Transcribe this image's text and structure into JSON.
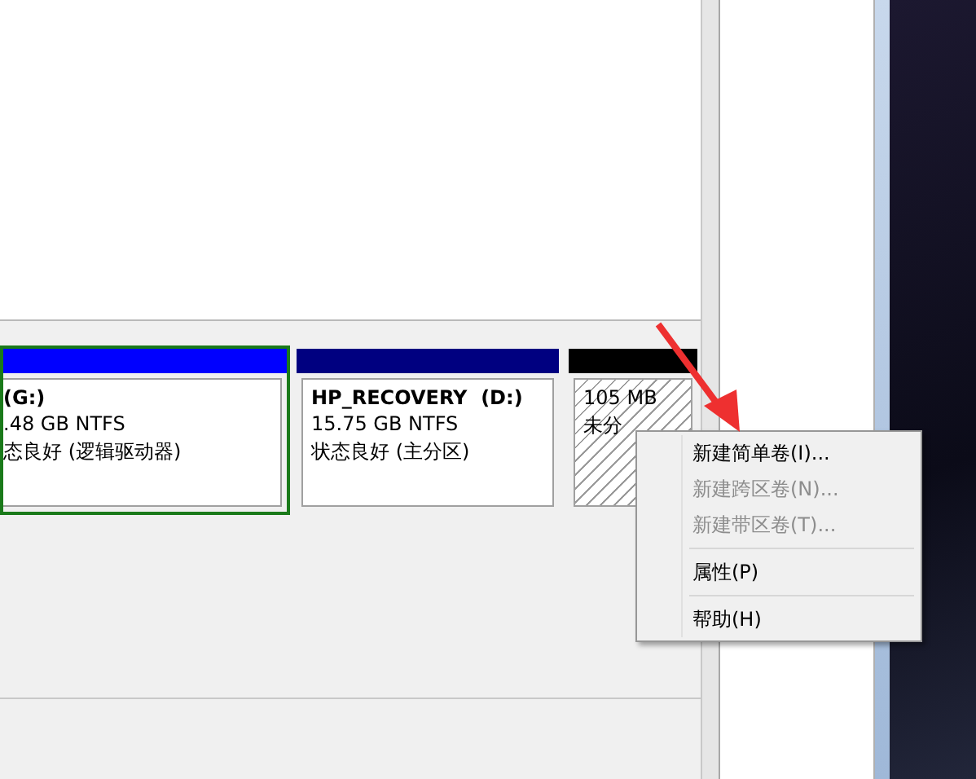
{
  "partitions": [
    {
      "name": "(G:)",
      "size": ".48 GB NTFS",
      "status": "态良好 (逻辑驱动器)",
      "kind": "logical",
      "selected": true
    },
    {
      "name": "HP_RECOVERY  (D:)",
      "size": "15.75 GB NTFS",
      "status": "状态良好 (主分区)",
      "kind": "primary",
      "selected": false
    },
    {
      "size": "105 MB",
      "status": "未分",
      "kind": "unallocated",
      "selected": false
    }
  ],
  "context_menu": {
    "groups": [
      [
        {
          "label": "新建简单卷(I)...",
          "disabled": false
        },
        {
          "label": "新建跨区卷(N)...",
          "disabled": true
        },
        {
          "label": "新建带区卷(T)...",
          "disabled": true
        }
      ],
      [
        {
          "label": "属性(P)",
          "disabled": false
        }
      ],
      [
        {
          "label": "帮助(H)",
          "disabled": false
        }
      ]
    ]
  }
}
